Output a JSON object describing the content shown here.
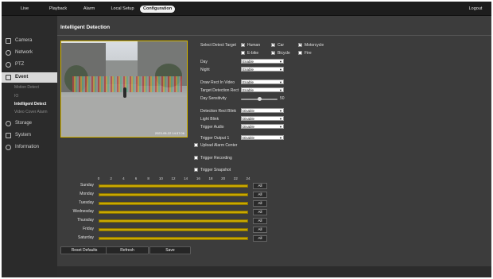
{
  "nav": {
    "items": [
      "Live",
      "Playback",
      "Alarm",
      "Local Setup",
      "Configuration"
    ],
    "active": "Configuration",
    "logout": "Logout"
  },
  "sidebar": {
    "sections": [
      {
        "label": "Camera",
        "icon": "camera-icon"
      },
      {
        "label": "Network",
        "icon": "network-icon"
      },
      {
        "label": "PTZ",
        "icon": "ptz-icon"
      },
      {
        "label": "Event",
        "icon": "event-icon"
      },
      {
        "label": "Storage",
        "icon": "storage-icon"
      },
      {
        "label": "System",
        "icon": "system-icon"
      },
      {
        "label": "Information",
        "icon": "information-icon"
      }
    ],
    "event_subitems": [
      "Motion Detect",
      "IO",
      "Intelligent Detect",
      "Video Cover Alarm"
    ],
    "active_section": "Event",
    "active_subitem": "Intelligent Detect"
  },
  "page_title": "Intelligent Detection",
  "video": {
    "osd_text": "2023-05-22 14:37:06"
  },
  "detect_target": {
    "label": "Select Detect Target",
    "options": [
      {
        "label": "Human",
        "checked": true
      },
      {
        "label": "Car",
        "checked": true
      },
      {
        "label": "Motorcycle",
        "checked": true
      },
      {
        "label": "E-bike",
        "checked": false
      },
      {
        "label": "Bicycle",
        "checked": true
      },
      {
        "label": "Fire",
        "checked": false
      }
    ]
  },
  "settings": {
    "day": {
      "label": "Day",
      "value": "Enable"
    },
    "night": {
      "label": "Night",
      "value": "Enable"
    },
    "draw_rect": {
      "label": "Draw Rect In Video",
      "value": "Enable"
    },
    "target_rect": {
      "label": "Target Detection Rect",
      "value": "Enable"
    },
    "day_sensitivity": {
      "label": "Day Sensitivity",
      "value": "50",
      "fraction": 0.5
    },
    "rect_blink": {
      "label": "Detection Rect Blink",
      "value": "Disable"
    },
    "light_blink": {
      "label": "Light Blink",
      "value": "Disable"
    },
    "trigger_audio": {
      "label": "Trigger Audio",
      "value": "Disable"
    },
    "trigger_output": {
      "label": "Trigger Output 1",
      "value": "Disable"
    }
  },
  "checkboxes": {
    "upload_alarm": "Upload Alarm Center",
    "trigger_recording": "Trigger Recording",
    "trigger_snapshot": "Trigger Snapshot"
  },
  "schedule": {
    "hours": [
      "0",
      "2",
      "4",
      "6",
      "8",
      "10",
      "12",
      "14",
      "16",
      "18",
      "20",
      "22",
      "24"
    ],
    "days": [
      "Sunday",
      "Monday",
      "Tuesday",
      "Wednesday",
      "Thursday",
      "Friday",
      "Saturday"
    ],
    "all_label": "All"
  },
  "buttons": {
    "reset": "Reset Defaults",
    "refresh": "Refresh",
    "save": "Save"
  },
  "colors": {
    "schedule_bar": "#c9a800",
    "accent_border": "#d8b800"
  }
}
